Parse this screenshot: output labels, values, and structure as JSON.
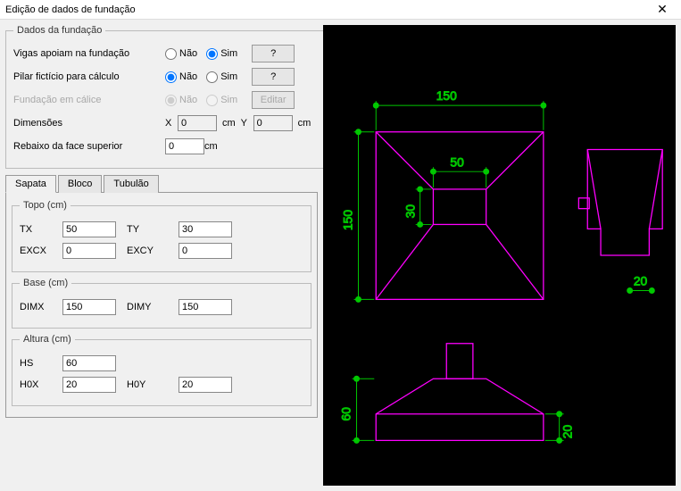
{
  "window": {
    "title": "Edição de dados de fundação"
  },
  "dados": {
    "legend": "Dados da fundação",
    "vigas_label": "Vigas apoiam na fundação",
    "pilar_label": "Pilar fictício para cálculo",
    "calice_label": "Fundação em cálice",
    "opt_nao": "Não",
    "opt_sim": "Sim",
    "btn_q": "?",
    "btn_editar": "Editar",
    "dim_label": "Dimensões",
    "dim_X": "X",
    "dim_Y": "Y",
    "dim_xval": "0",
    "dim_yval": "0",
    "dim_unit": "cm",
    "rebaixo_label": "Rebaixo da face superior",
    "rebaixo_val": "0",
    "rebaixo_unit": "cm"
  },
  "tabs": {
    "sapata": "Sapata",
    "bloco": "Bloco",
    "tubulao": "Tubulão"
  },
  "topo": {
    "legend": "Topo (cm)",
    "TX_l": "TX",
    "TX_v": "50",
    "TY_l": "TY",
    "TY_v": "30",
    "EXCX_l": "EXCX",
    "EXCX_v": "0",
    "EXCY_l": "EXCY",
    "EXCY_v": "0"
  },
  "base": {
    "legend": "Base (cm)",
    "DIMX_l": "DIMX",
    "DIMX_v": "150",
    "DIMY_l": "DIMY",
    "DIMY_v": "150"
  },
  "altura": {
    "legend": "Altura (cm)",
    "HS_l": "HS",
    "HS_v": "60",
    "H0X_l": "H0X",
    "H0X_v": "20",
    "H0Y_l": "H0Y",
    "H0Y_v": "20"
  },
  "cad": {
    "dim150": "150",
    "dim50": "50",
    "dim30": "30",
    "dim150v": "150",
    "dim20": "20",
    "dim60": "60",
    "dim20b": "20"
  }
}
